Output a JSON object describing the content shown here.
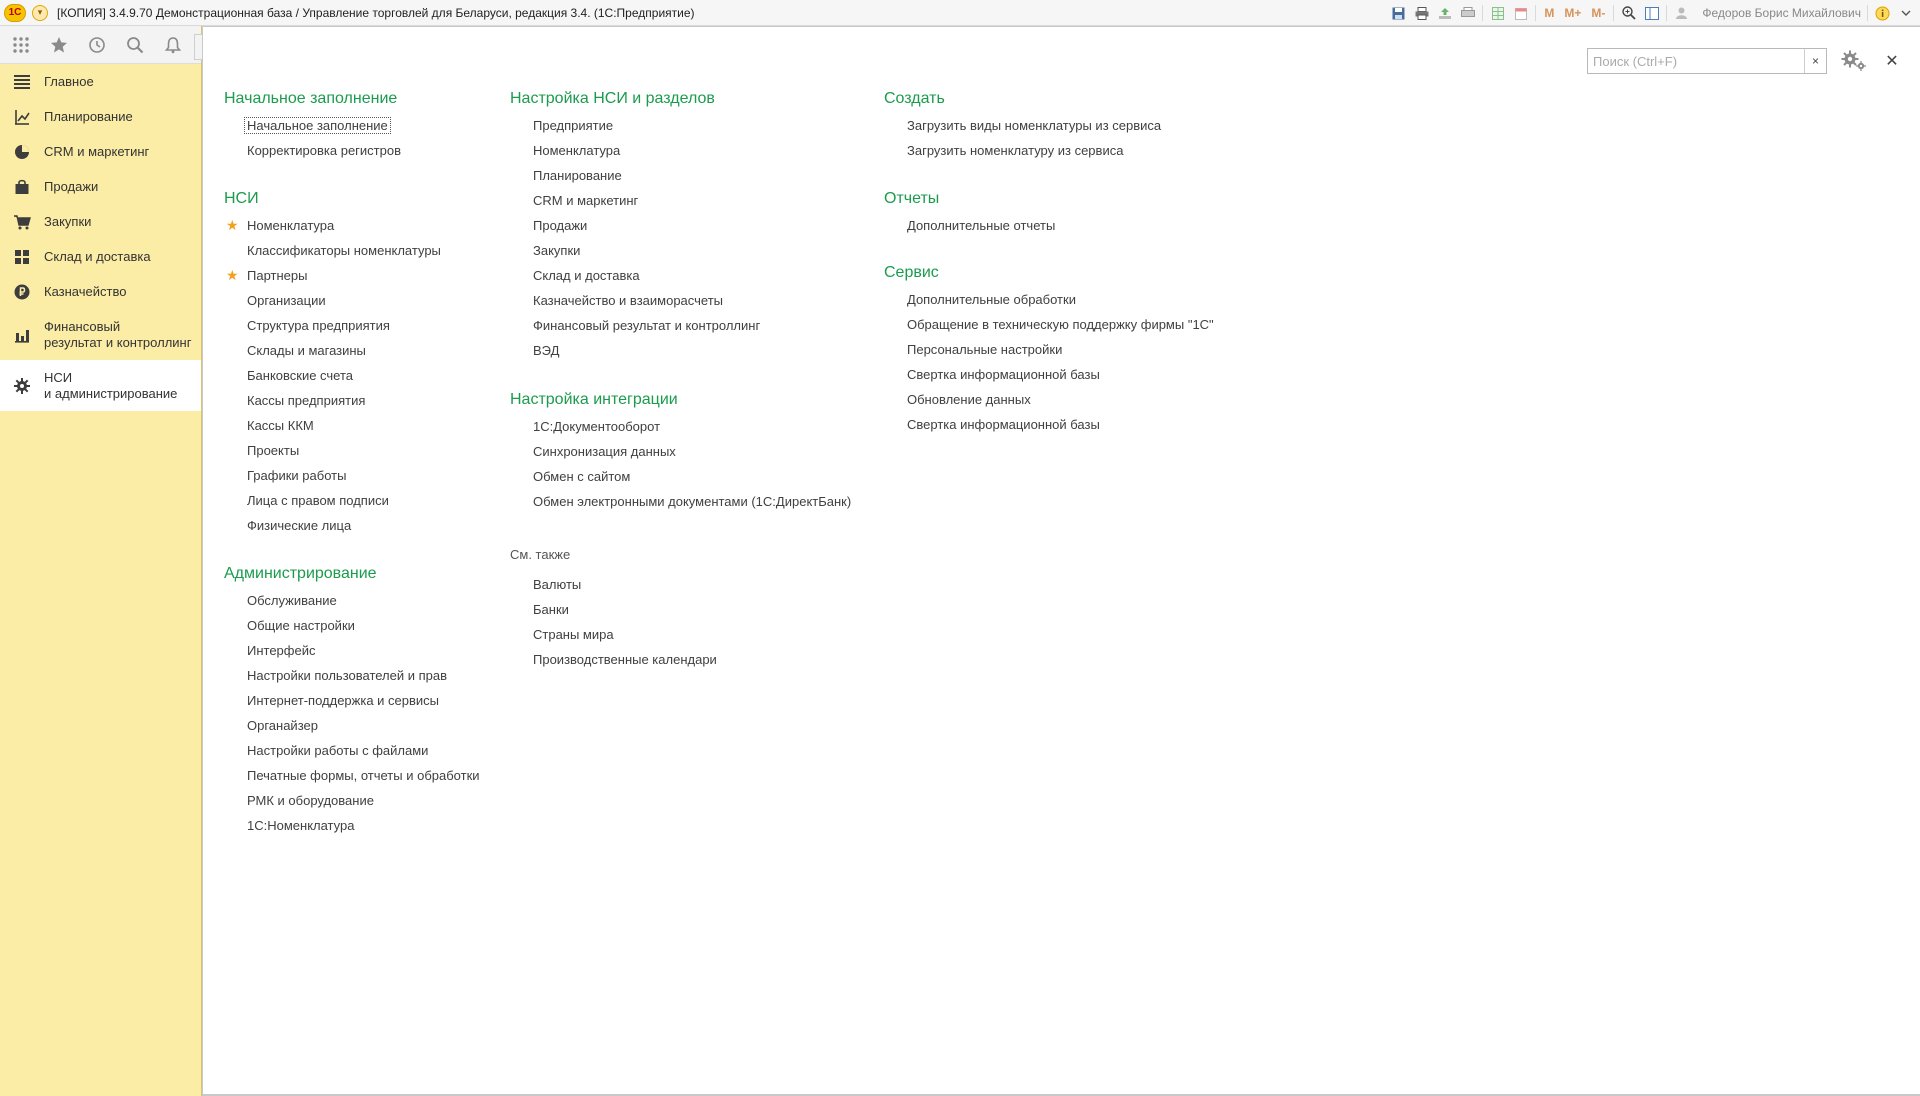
{
  "titlebar": {
    "logo": "1С",
    "menu_glyph": "▾",
    "title": "[КОПИЯ] 3.4.9.70 Демонстрационная база / Управление торговлей для Беларуси, редакция 3.4.   (1С:Предприятие)",
    "m_label": "M",
    "m_plus_label": "M+",
    "m_minus_label": "M-",
    "user": "Федоров Борис Михайлович"
  },
  "sidebar": {
    "items": [
      {
        "label": "Главное",
        "icon": "menu-icon"
      },
      {
        "label": "Планирование",
        "icon": "planning-icon"
      },
      {
        "label": "CRM и маркетинг",
        "icon": "crm-icon"
      },
      {
        "label": "Продажи",
        "icon": "sales-bag-icon"
      },
      {
        "label": "Закупки",
        "icon": "cart-icon"
      },
      {
        "label": "Склад и доставка",
        "icon": "warehouse-icon"
      },
      {
        "label": "Казначейство",
        "icon": "treasury-icon"
      },
      {
        "label": "Финансовый\nрезультат и контроллинг",
        "icon": "chart-icon"
      },
      {
        "label": "НСИ\nи администрирование",
        "icon": "gear-icon",
        "active": true
      }
    ]
  },
  "search": {
    "placeholder": "Поиск (Ctrl+F)",
    "value": "",
    "clear": "×"
  },
  "close_glyph": "✕",
  "columns": {
    "col1": {
      "sections": [
        {
          "title": "Начальное заполнение",
          "items": [
            "Начальное заполнение",
            "Корректировка регистров"
          ]
        },
        {
          "title": "НСИ",
          "items": [
            "Номенклатура",
            "Классификаторы номенклатуры",
            "Партнеры",
            "Организации",
            "Структура предприятия",
            "Склады и магазины",
            "Банковские счета",
            "Кассы предприятия",
            "Кассы ККМ",
            "Проекты",
            "Графики работы",
            "Лица с правом подписи",
            "Физические лица"
          ]
        },
        {
          "title": "Администрирование",
          "items": [
            "Обслуживание",
            "Общие настройки",
            "Интерфейс",
            "Настройки пользователей и прав",
            "Интернет-поддержка и сервисы",
            "Органайзер",
            "Настройки работы с файлами",
            "Печатные формы, отчеты и обработки",
            "РМК и оборудование",
            "1С:Номенклатура"
          ]
        }
      ]
    },
    "col2": {
      "sections": [
        {
          "title": "Настройка НСИ и разделов",
          "items": [
            "Предприятие",
            "Номенклатура",
            "Планирование",
            "CRM и маркетинг",
            "Продажи",
            "Закупки",
            "Склад и доставка",
            "Казначейство и взаиморасчеты",
            "Финансовый результат и контроллинг",
            "ВЭД"
          ]
        },
        {
          "title": "Настройка интеграции",
          "items": [
            "1С:Документооборот",
            "Синхронизация данных",
            "Обмен с сайтом",
            "Обмен электронными документами (1С:ДиректБанк)"
          ]
        },
        {
          "title": "См. также",
          "items": [
            "Валюты",
            "Банки",
            "Страны мира",
            "Производственные календари"
          ]
        }
      ]
    },
    "col3": {
      "sections": [
        {
          "title": "Создать",
          "items": [
            "Загрузить виды номенклатуры из сервиса",
            "Загрузить номенклатуру из сервиса"
          ]
        },
        {
          "title": "Отчеты",
          "items": [
            "Дополнительные отчеты"
          ]
        },
        {
          "title": "Сервис",
          "items": [
            "Дополнительные обработки",
            "Обращение в техническую поддержку фирмы \"1С\"",
            "Персональные настройки",
            "Свертка информационной базы",
            "Обновление данных",
            "Свертка информационной базы"
          ]
        }
      ]
    }
  },
  "favorites": {
    "star_glyph": "★"
  },
  "colors": {
    "section_title": "#1b9c4d",
    "sidebar_bg": "#fbeda6",
    "favorite_star": "#f2a01e"
  }
}
